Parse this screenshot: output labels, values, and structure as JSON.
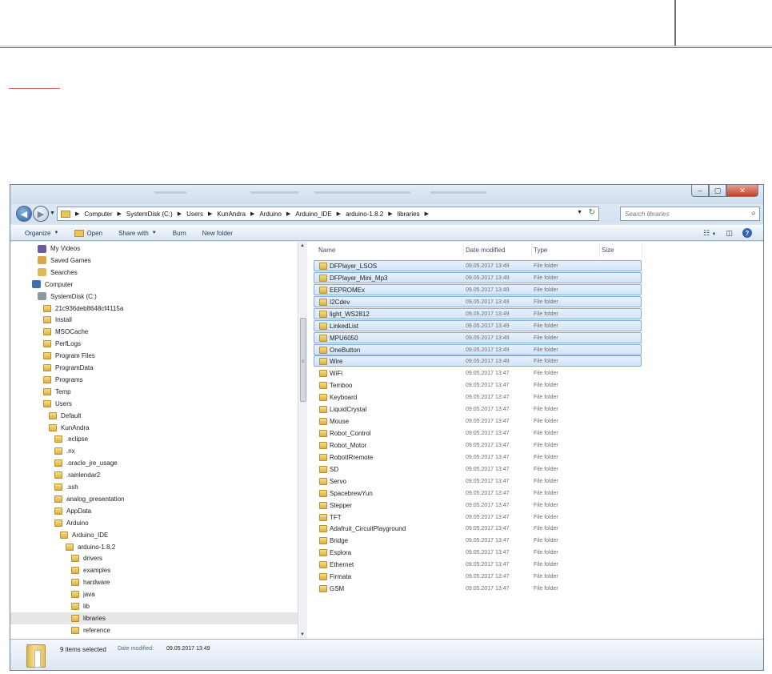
{
  "window": {
    "caption_buttons": [
      "–",
      "▢",
      "✕"
    ]
  },
  "address": {
    "crumbs": [
      "Computer",
      "SystemDisk (C:)",
      "Users",
      "KunAndra",
      "Arduino",
      "Arduino_IDE",
      "arduino-1.8.2",
      "libraries"
    ],
    "search_placeholder": "Search libraries"
  },
  "toolbar": {
    "organize": "Organize",
    "open": "Open",
    "share_with": "Share with",
    "burn": "Burn",
    "new_folder": "New folder"
  },
  "nav_tree": [
    {
      "label": "My Videos",
      "indent": 2,
      "icon": "videos-icon"
    },
    {
      "label": "Saved Games",
      "indent": 2,
      "icon": "saved-games-icon"
    },
    {
      "label": "Searches",
      "indent": 2,
      "icon": "searches-icon"
    },
    {
      "label": "Computer",
      "indent": 1,
      "icon": "computer-icon"
    },
    {
      "label": "SystemDisk (C:)",
      "indent": 2,
      "icon": "drive-icon"
    },
    {
      "label": "21c936deb8648cf4115a",
      "indent": 3,
      "icon": "folder-icon"
    },
    {
      "label": "Install",
      "indent": 3,
      "icon": "folder-icon"
    },
    {
      "label": "MSOCache",
      "indent": 3,
      "icon": "folder-icon"
    },
    {
      "label": "PerfLogs",
      "indent": 3,
      "icon": "folder-icon"
    },
    {
      "label": "Program Files",
      "indent": 3,
      "icon": "folder-icon"
    },
    {
      "label": "ProgramData",
      "indent": 3,
      "icon": "folder-icon"
    },
    {
      "label": "Programs",
      "indent": 3,
      "icon": "folder-icon"
    },
    {
      "label": "Temp",
      "indent": 3,
      "icon": "folder-icon"
    },
    {
      "label": "Users",
      "indent": 3,
      "icon": "folder-icon"
    },
    {
      "label": "Default",
      "indent": 4,
      "icon": "folder-icon"
    },
    {
      "label": "KunAndra",
      "indent": 4,
      "icon": "folder-icon"
    },
    {
      "label": ".eclipse",
      "indent": 5,
      "icon": "folder-icon"
    },
    {
      "label": ".nx",
      "indent": 5,
      "icon": "folder-icon"
    },
    {
      "label": ".oracle_jre_usage",
      "indent": 5,
      "icon": "folder-icon"
    },
    {
      "label": ".rainlendar2",
      "indent": 5,
      "icon": "folder-icon"
    },
    {
      "label": ".ssh",
      "indent": 5,
      "icon": "folder-icon"
    },
    {
      "label": "analog_presentation",
      "indent": 5,
      "icon": "folder-icon"
    },
    {
      "label": "AppData",
      "indent": 5,
      "icon": "folder-icon"
    },
    {
      "label": "Arduino",
      "indent": 5,
      "icon": "folder-icon"
    },
    {
      "label": "Arduino_IDE",
      "indent": 6,
      "icon": "folder-icon"
    },
    {
      "label": "arduino-1.8.2",
      "indent": 7,
      "icon": "folder-icon"
    },
    {
      "label": "drivers",
      "indent": 8,
      "icon": "folder-icon"
    },
    {
      "label": "examples",
      "indent": 8,
      "icon": "folder-icon"
    },
    {
      "label": "hardware",
      "indent": 8,
      "icon": "folder-icon"
    },
    {
      "label": "java",
      "indent": 8,
      "icon": "folder-icon"
    },
    {
      "label": "lib",
      "indent": 8,
      "icon": "folder-icon"
    },
    {
      "label": "libraries",
      "indent": 8,
      "icon": "folder-icon",
      "selected": true
    },
    {
      "label": "reference",
      "indent": 8,
      "icon": "folder-icon"
    }
  ],
  "columns": {
    "name": "Name",
    "date": "Date modified",
    "type": "Type",
    "size": "Size"
  },
  "files": [
    {
      "name": "DFPlayer_LSOS",
      "date": "09.05.2017 13:49",
      "type": "File folder",
      "selected": true
    },
    {
      "name": "DFPlayer_Mini_Mp3",
      "date": "09.05.2017 13:49",
      "type": "File folder",
      "selected": true
    },
    {
      "name": "EEPROMEx",
      "date": "09.05.2017 13:49",
      "type": "File folder",
      "selected": true
    },
    {
      "name": "I2Cdev",
      "date": "09.05.2017 13:49",
      "type": "File folder",
      "selected": true
    },
    {
      "name": "light_WS2812",
      "date": "09.05.2017 13:49",
      "type": "File folder",
      "selected": true
    },
    {
      "name": "LinkedList",
      "date": "09.05.2017 13:49",
      "type": "File folder",
      "selected": true
    },
    {
      "name": "MPU6050",
      "date": "09.05.2017 13:49",
      "type": "File folder",
      "selected": true
    },
    {
      "name": "OneButton",
      "date": "09.05.2017 13:49",
      "type": "File folder",
      "selected": true
    },
    {
      "name": "Wire",
      "date": "09.05.2017 13:49",
      "type": "File folder",
      "selected": true
    },
    {
      "name": "WiFi",
      "date": "09.05.2017 13:47",
      "type": "File folder"
    },
    {
      "name": "Temboo",
      "date": "09.05.2017 13:47",
      "type": "File folder"
    },
    {
      "name": "Keyboard",
      "date": "09.05.2017 13:47",
      "type": "File folder"
    },
    {
      "name": "LiquidCrystal",
      "date": "09.05.2017 13:47",
      "type": "File folder"
    },
    {
      "name": "Mouse",
      "date": "09.05.2017 13:47",
      "type": "File folder"
    },
    {
      "name": "Robot_Control",
      "date": "09.05.2017 13:47",
      "type": "File folder"
    },
    {
      "name": "Robot_Motor",
      "date": "09.05.2017 13:47",
      "type": "File folder"
    },
    {
      "name": "RobotIRremote",
      "date": "09.05.2017 13:47",
      "type": "File folder"
    },
    {
      "name": "SD",
      "date": "09.05.2017 13:47",
      "type": "File folder"
    },
    {
      "name": "Servo",
      "date": "09.05.2017 13:47",
      "type": "File folder"
    },
    {
      "name": "SpacebrewYun",
      "date": "09.05.2017 13:47",
      "type": "File folder"
    },
    {
      "name": "Stepper",
      "date": "09.05.2017 13:47",
      "type": "File folder"
    },
    {
      "name": "TFT",
      "date": "09.05.2017 13:47",
      "type": "File folder"
    },
    {
      "name": "Adafruit_CircuitPlayground",
      "date": "09.05.2017 13:47",
      "type": "File folder"
    },
    {
      "name": "Bridge",
      "date": "09.05.2017 13:47",
      "type": "File folder"
    },
    {
      "name": "Esplora",
      "date": "09.05.2017 13:47",
      "type": "File folder"
    },
    {
      "name": "Ethernet",
      "date": "09.05.2017 13:47",
      "type": "File folder"
    },
    {
      "name": "Firmata",
      "date": "09.05.2017 13:47",
      "type": "File folder"
    },
    {
      "name": "GSM",
      "date": "09.05.2017 13:47",
      "type": "File folder"
    }
  ],
  "details": {
    "count": "9 items selected",
    "date_label": "Date modified:",
    "date_value": "09.05.2017 13:49"
  },
  "colors": {
    "selection_fill": "#d9e8fb",
    "selection_border": "#84acdd",
    "folder_yellow": "#e8c55a"
  }
}
